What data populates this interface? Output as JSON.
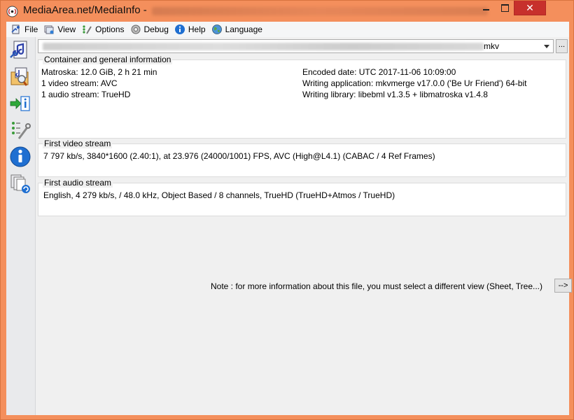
{
  "window": {
    "title": "MediaArea.net/MediaInfo - ",
    "close_glyph": "✕"
  },
  "menu": {
    "items": [
      {
        "label": "File",
        "icon": "file-icon"
      },
      {
        "label": "View",
        "icon": "view-icon"
      },
      {
        "label": "Options",
        "icon": "options-icon"
      },
      {
        "label": "Debug",
        "icon": "debug-icon"
      },
      {
        "label": "Help",
        "icon": "help-icon"
      },
      {
        "label": "Language",
        "icon": "language-icon"
      }
    ]
  },
  "toolbar": {
    "items": [
      "open-file-icon",
      "open-folder-icon",
      "export-icon",
      "options-icon",
      "about-icon",
      "knowledge-base-icon"
    ]
  },
  "file_select": {
    "extension": "mkv",
    "browse_label": "..."
  },
  "general": {
    "title": "Container and general information",
    "left": [
      "Matroska: 12.0 GiB, 2 h 21 min",
      "1 video stream: AVC",
      "1 audio stream: TrueHD"
    ],
    "right": [
      "Encoded date: UTC 2017-11-06 10:09:00",
      "Writing application: mkvmerge v17.0.0 ('Be Ur Friend') 64-bit",
      "Writing library: libebml v1.3.5 + libmatroska v1.4.8"
    ]
  },
  "video": {
    "title": "First video stream",
    "text": "7 797 kb/s, 3840*1600 (2.40:1), at 23.976 (24000/1001) FPS, AVC (High@L4.1) (CABAC / 4 Ref Frames)"
  },
  "audio": {
    "title": "First audio stream",
    "text": "English, 4 279 kb/s,  / 48.0 kHz, Object Based / 8 channels, TrueHD (TrueHD+Atmos / TrueHD)"
  },
  "note": {
    "text": "Note : for more information about this file, you must select a different view (Sheet, Tree...)",
    "button_label": "-->"
  },
  "colors": {
    "titlebar": "#f48f5c",
    "close_button": "#c7302c",
    "panel_bg": "#f0f0f0"
  }
}
